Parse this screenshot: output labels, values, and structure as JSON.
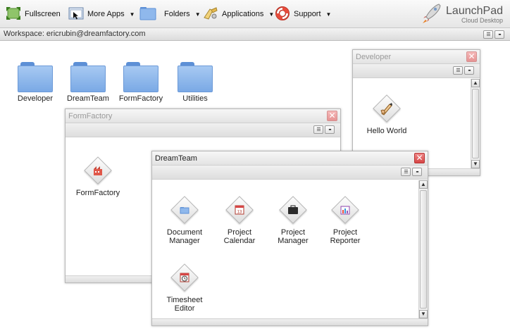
{
  "toolbar": {
    "fullscreen": "Fullscreen",
    "more_apps": "More Apps",
    "folders": "Folders",
    "applications": "Applications",
    "support": "Support",
    "brand_title": "LaunchPad",
    "brand_subtitle": "Cloud Desktop"
  },
  "workspace": {
    "label": "Workspace: ericrubin@dreamfactory.com"
  },
  "desktop_folders": [
    {
      "label": "Developer"
    },
    {
      "label": "DreamTeam"
    },
    {
      "label": "FormFactory"
    },
    {
      "label": "Utilities"
    }
  ],
  "windows": {
    "developer": {
      "title": "Developer",
      "apps": [
        {
          "label": "Hello World",
          "icon": "pen-hand-icon"
        }
      ]
    },
    "formfactory": {
      "title": "FormFactory",
      "apps": [
        {
          "label": "FormFactory",
          "icon": "formfactory-icon"
        }
      ]
    },
    "dreamteam": {
      "title": "DreamTeam",
      "apps": [
        {
          "label_line1": "Document",
          "label_line2": "Manager",
          "icon": "document-folder-icon"
        },
        {
          "label_line1": "Project",
          "label_line2": "Calendar",
          "icon": "calendar-icon",
          "glyph_text": "13"
        },
        {
          "label_line1": "Project",
          "label_line2": "Manager",
          "icon": "briefcase-icon"
        },
        {
          "label_line1": "Project",
          "label_line2": "Reporter",
          "icon": "bar-chart-icon"
        },
        {
          "label_line1": "Timesheet",
          "label_line2": "Editor",
          "icon": "clock-icon"
        }
      ]
    }
  },
  "colors": {
    "folder_blue": "#7aa9e5",
    "close_red": "#d64545"
  }
}
